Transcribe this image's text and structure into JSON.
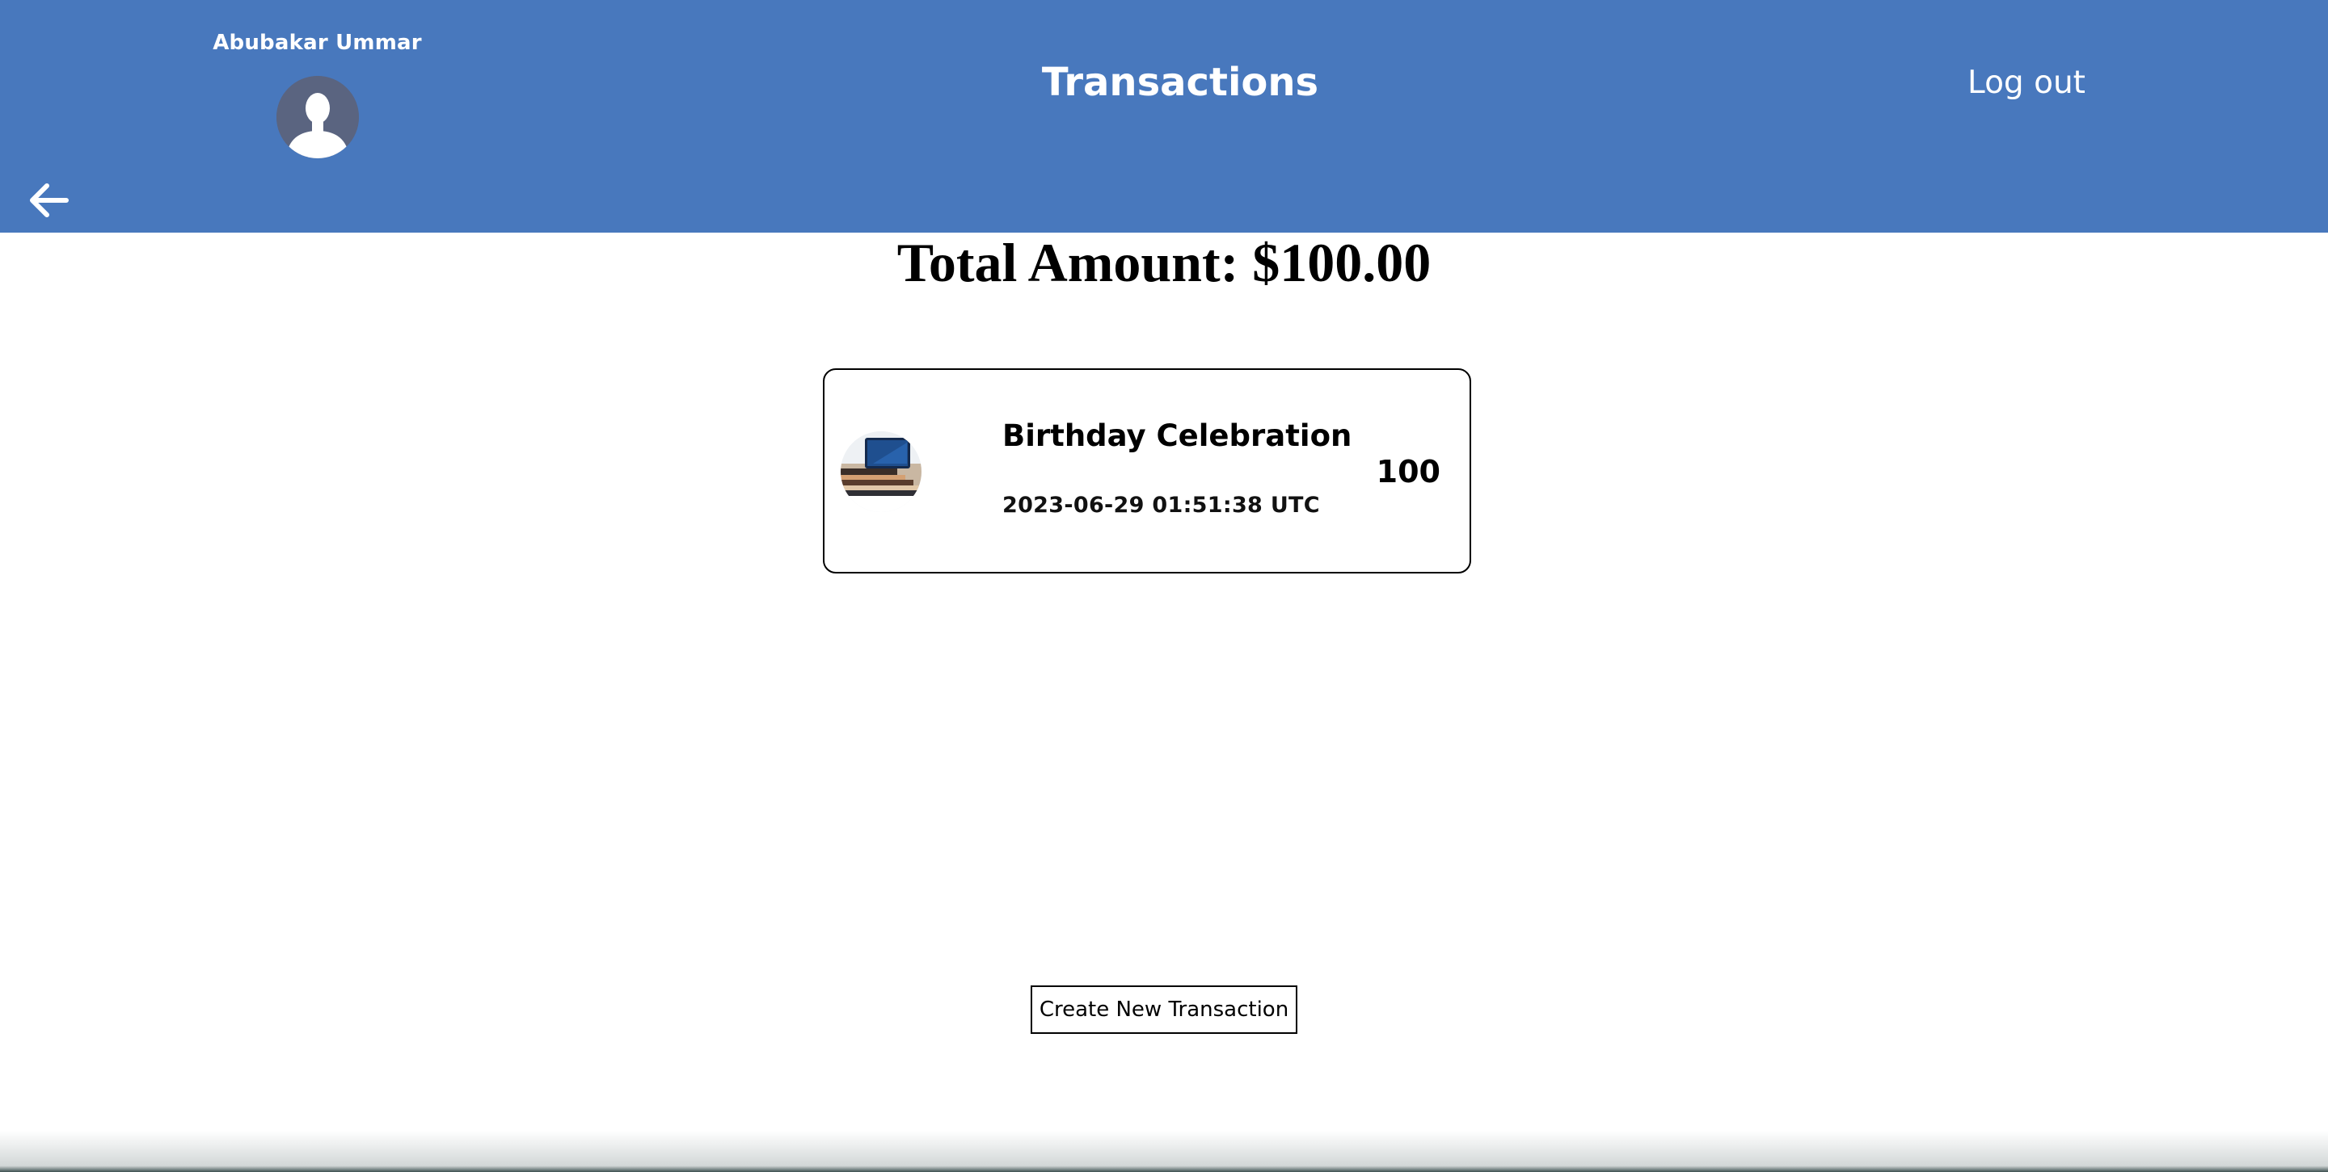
{
  "colors": {
    "header_bg": "#4878bd",
    "header_text": "#ffffff"
  },
  "header": {
    "user_name": "Abubakar Ummar",
    "avatar_icon": "user-silhouette-icon",
    "title": "Transactions",
    "logout_label": "Log out",
    "back_icon": "arrow-left-icon"
  },
  "summary": {
    "total_label": "Total Amount: $100.00"
  },
  "transactions": [
    {
      "name": "Birthday Celebration",
      "date": "2023-06-29 01:51:38 UTC",
      "amount": "100",
      "thumbnail_icon": "transaction-thumbnail-image"
    }
  ],
  "actions": {
    "create_label": "Create New Transaction"
  }
}
